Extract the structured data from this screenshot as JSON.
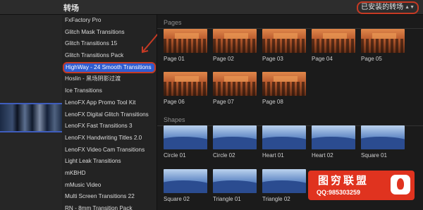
{
  "header": {
    "title": "转场",
    "filter_label": "已安装的转场"
  },
  "sidebar": {
    "items": [
      {
        "label": "FxFactory Pro"
      },
      {
        "label": "Glitch Mask Transitions"
      },
      {
        "label": "Glitch Transitions 15"
      },
      {
        "label": "Glitch Transitions Pack"
      },
      {
        "label": "HighWay - 24 Smooth Transitions"
      },
      {
        "label": "Hoslin - 黑场阴影过渡"
      },
      {
        "label": "Ice Transitions"
      },
      {
        "label": "LenoFX App Promo Tool Kit"
      },
      {
        "label": "LenoFX Digital Glitch Transitions"
      },
      {
        "label": "LenoFX Fast Transitions 3"
      },
      {
        "label": "LenoFX Handwriting Titles 2.0"
      },
      {
        "label": "LenoFX Video Cam Transitions"
      },
      {
        "label": "Light Leak Transitions"
      },
      {
        "label": "mKBHD"
      },
      {
        "label": "mMusic Video"
      },
      {
        "label": "Multi Screen Transitions 22"
      },
      {
        "label": "RN - 8mm Transition Pack"
      }
    ]
  },
  "browser": {
    "sections": [
      {
        "title": "Pages",
        "items": [
          {
            "label": "Page 01",
            "style": "fire"
          },
          {
            "label": "Page 02",
            "style": "fire"
          },
          {
            "label": "Page 03",
            "style": "fire"
          },
          {
            "label": "Page 04",
            "style": "fire"
          },
          {
            "label": "Page 05",
            "style": "fire"
          },
          {
            "label": "Page 06",
            "style": "fire"
          },
          {
            "label": "Page 07",
            "style": "fire"
          },
          {
            "label": "Page 08",
            "style": "fire"
          }
        ]
      },
      {
        "title": "Shapes",
        "items": [
          {
            "label": "Circle 01",
            "style": "blue"
          },
          {
            "label": "Circle 02",
            "style": "blue"
          },
          {
            "label": "Heart 01",
            "style": "blue"
          },
          {
            "label": "Heart 02",
            "style": "blue"
          },
          {
            "label": "Square 01",
            "style": "blue"
          },
          {
            "label": "Square 02",
            "style": "blue"
          },
          {
            "label": "Triangle 01",
            "style": "blue"
          },
          {
            "label": "Triangle 02",
            "style": "blue"
          }
        ]
      }
    ]
  },
  "watermark": {
    "main": "图穷联盟",
    "sub": "QQ:985303259"
  },
  "colors": {
    "selection": "#2f5cd1",
    "annotation": "#c63a24",
    "badge": "#e0331f"
  }
}
